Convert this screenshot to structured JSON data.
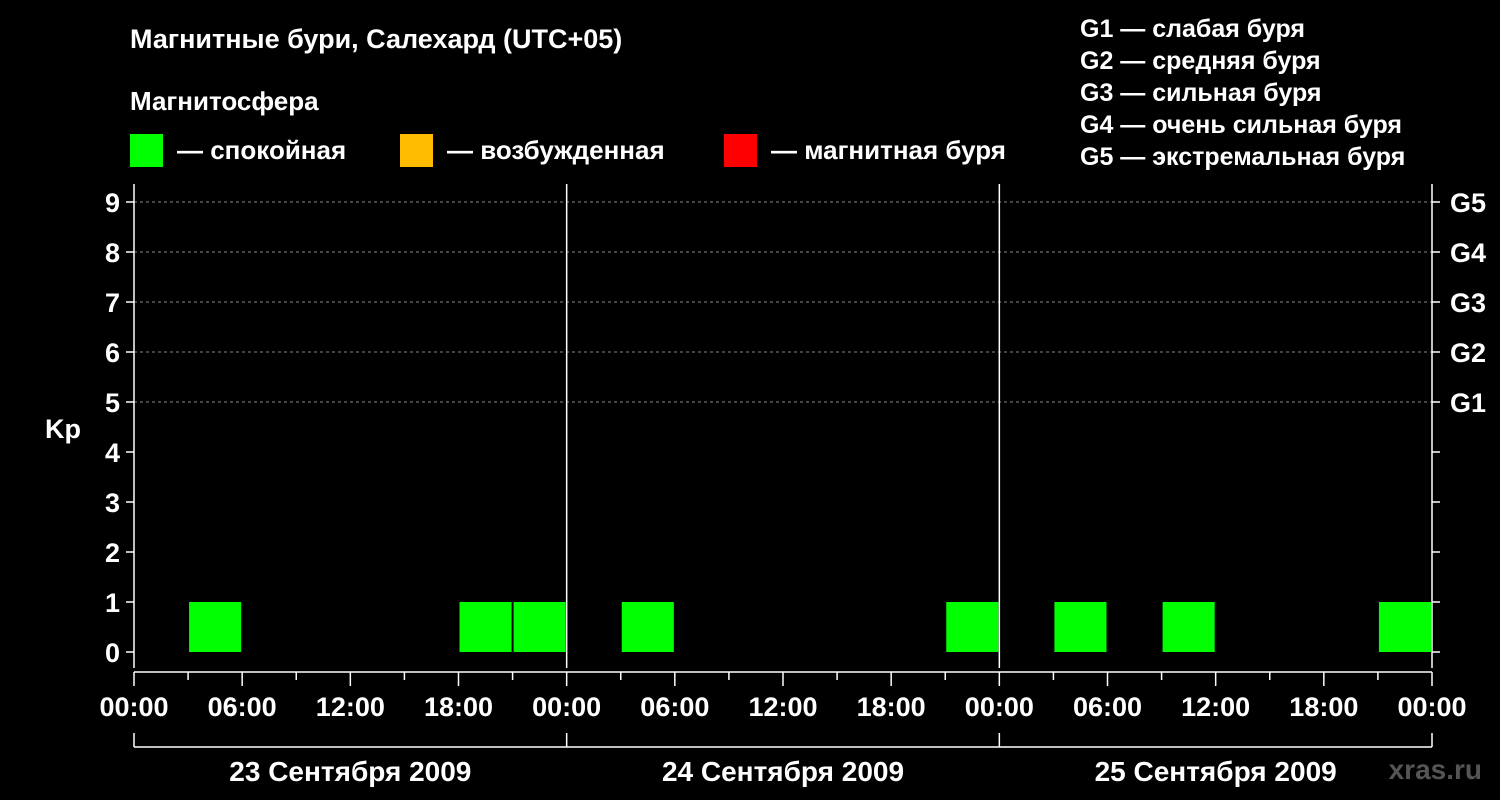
{
  "title": "Магнитные бури, Салехард (UTC+05)",
  "subtitle": "Магнитосфера",
  "legend": [
    {
      "label": "— спокойная",
      "color": "#00ff00"
    },
    {
      "label": "— возбужденная",
      "color": "#ffbb00"
    },
    {
      "label": "— магнитная буря",
      "color": "#ff0000"
    }
  ],
  "g_scale": [
    "G1 — слабая буря",
    "G2 — средняя буря",
    "G3 — сильная буря",
    "G4 — очень сильная буря",
    "G5 — экстремальная буря"
  ],
  "footer": "xras.ru",
  "chart_data": {
    "type": "bar",
    "ylabel": "Kp",
    "ylim": [
      0,
      9
    ],
    "y_ticks": [
      "0",
      "1",
      "2",
      "3",
      "4",
      "5",
      "6",
      "7",
      "8",
      "9"
    ],
    "right_ticks": [
      {
        "value": 5,
        "label": "G1"
      },
      {
        "value": 6,
        "label": "G2"
      },
      {
        "value": 7,
        "label": "G3"
      },
      {
        "value": 8,
        "label": "G4"
      },
      {
        "value": 9,
        "label": "G5"
      }
    ],
    "x_ticks": [
      "00:00",
      "06:00",
      "12:00",
      "18:00",
      "00:00",
      "06:00",
      "12:00",
      "18:00",
      "00:00",
      "06:00",
      "12:00",
      "18:00",
      "00:00"
    ],
    "days": [
      "23 Сентября 2009",
      "24 Сентября 2009",
      "25 Сентября 2009"
    ],
    "grid": true,
    "legend_position": "top",
    "interval_hours": 3,
    "values": [
      0,
      1,
      0,
      0,
      0,
      0,
      1,
      1,
      0,
      1,
      0,
      0,
      0,
      0,
      0,
      1,
      0,
      1,
      0,
      1,
      0,
      0,
      0,
      1
    ],
    "bar_color": "#00ff00"
  }
}
